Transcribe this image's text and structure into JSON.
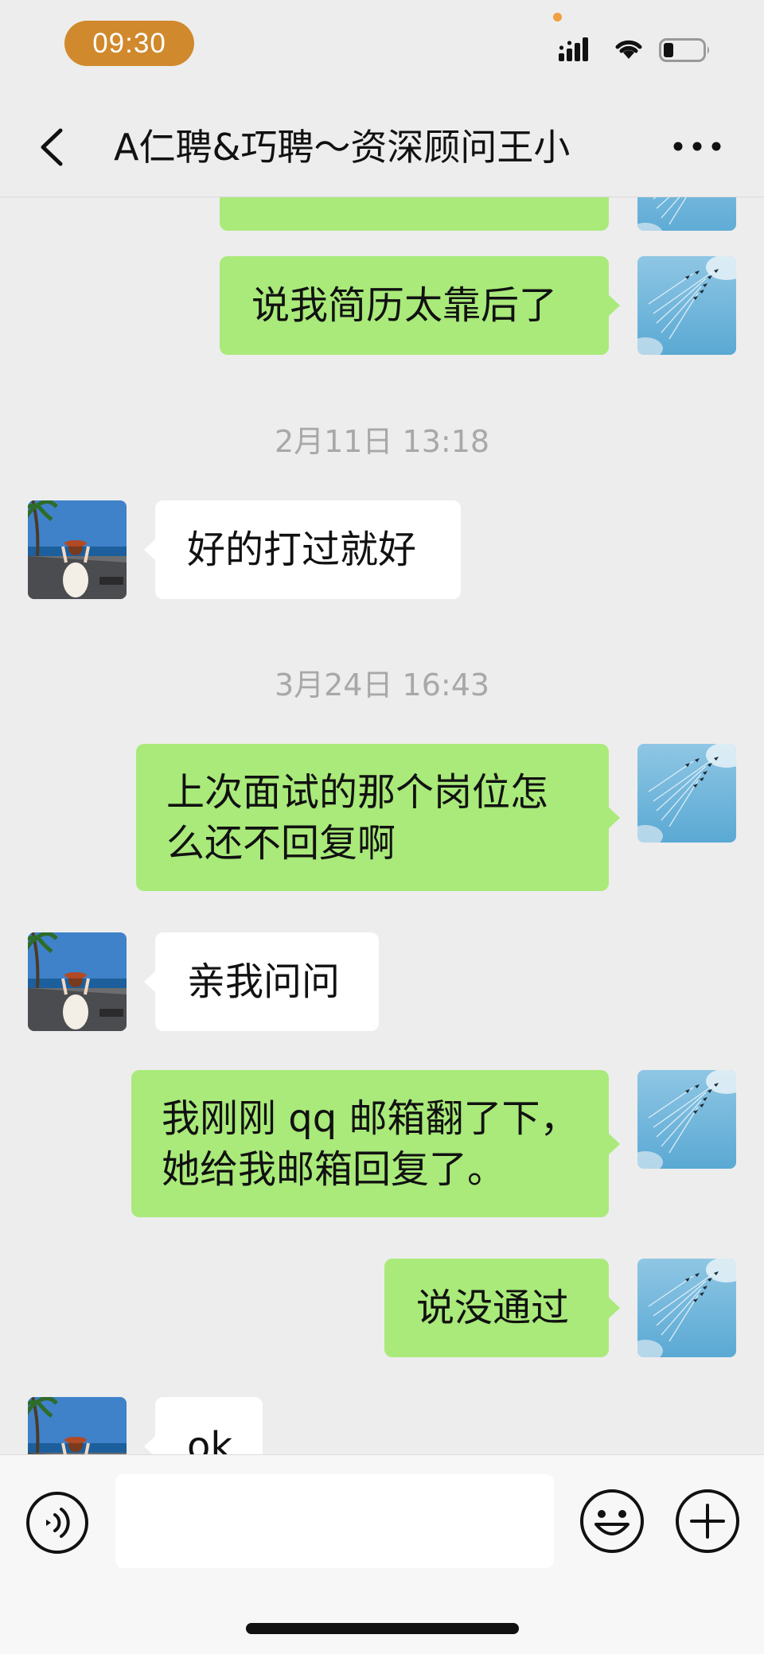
{
  "status_bar": {
    "time": "09:30",
    "signal_icon": "cellular-signal-icon",
    "wifi_icon": "wifi-icon",
    "battery_icon": "battery-icon",
    "battery_level": 0.25
  },
  "nav": {
    "back_icon": "chevron-left-icon",
    "title": "A仁聘&巧聘～资深顾问王小",
    "more_icon": "ellipsis-icon"
  },
  "messages": [
    {
      "type": "sent",
      "text": "说我简历太靠后了",
      "avatar": "user-avatar-jets"
    },
    {
      "type": "timestamp",
      "text": "2月11日 13:18"
    },
    {
      "type": "received",
      "text": "好的打过就好",
      "avatar": "contact-avatar-beach"
    },
    {
      "type": "timestamp",
      "text": "3月24日 16:43"
    },
    {
      "type": "sent",
      "text": "上次面试的那个岗位怎么还不回复啊",
      "avatar": "user-avatar-jets"
    },
    {
      "type": "received",
      "text": "亲我问问",
      "avatar": "contact-avatar-beach"
    },
    {
      "type": "sent",
      "text": "我刚刚 qq 邮箱翻了下，她给我邮箱回复了。",
      "avatar": "user-avatar-jets"
    },
    {
      "type": "sent",
      "text": "说没通过",
      "avatar": "user-avatar-jets"
    },
    {
      "type": "received",
      "text": "ok",
      "avatar": "contact-avatar-beach"
    }
  ],
  "input_bar": {
    "voice_icon": "voice-input-icon",
    "input_value": "",
    "emoji_icon": "emoji-icon",
    "plus_icon": "plus-icon"
  },
  "colors": {
    "background": "#ededed",
    "sent_bubble": "#a9ea7a",
    "received_bubble": "#ffffff",
    "time_pill": "#d0892c",
    "timestamp_text": "#a8a8a8"
  }
}
